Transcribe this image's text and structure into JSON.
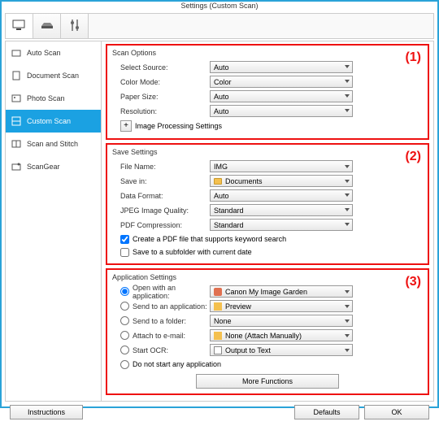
{
  "title": "Settings (Custom Scan)",
  "sidebar": {
    "items": [
      {
        "label": "Auto Scan"
      },
      {
        "label": "Document Scan"
      },
      {
        "label": "Photo Scan"
      },
      {
        "label": "Custom Scan"
      },
      {
        "label": "Scan and Stitch"
      },
      {
        "label": "ScanGear"
      }
    ]
  },
  "groups": {
    "scan": {
      "num": "(1)",
      "title": "Scan Options",
      "select_source_label": "Select Source:",
      "select_source_value": "Auto",
      "color_mode_label": "Color Mode:",
      "color_mode_value": "Color",
      "paper_size_label": "Paper Size:",
      "paper_size_value": "Auto",
      "resolution_label": "Resolution:",
      "resolution_value": "Auto",
      "expand_label": "Image Processing Settings"
    },
    "save": {
      "num": "(2)",
      "title": "Save Settings",
      "file_name_label": "File Name:",
      "file_name_value": "IMG",
      "save_in_label": "Save in:",
      "save_in_value": "Documents",
      "data_format_label": "Data Format:",
      "data_format_value": "Auto",
      "jpeg_label": "JPEG Image Quality:",
      "jpeg_value": "Standard",
      "pdf_label": "PDF Compression:",
      "pdf_value": "Standard",
      "chk_keyword": "Create a PDF file that supports keyword search",
      "chk_subfolder": "Save to a subfolder with current date"
    },
    "app": {
      "num": "(3)",
      "title": "Application Settings",
      "open_app_label": "Open with an application:",
      "open_app_value": "Canon My Image Garden",
      "send_app_label": "Send to an application:",
      "send_app_value": "Preview",
      "send_folder_label": "Send to a folder:",
      "send_folder_value": "None",
      "attach_label": "Attach to e-mail:",
      "attach_value": "None (Attach Manually)",
      "ocr_label": "Start OCR:",
      "ocr_value": "Output to Text",
      "none_label": "Do not start any application",
      "more_label": "More Functions"
    }
  },
  "footer": {
    "instructions": "Instructions",
    "defaults": "Defaults",
    "ok": "OK"
  }
}
